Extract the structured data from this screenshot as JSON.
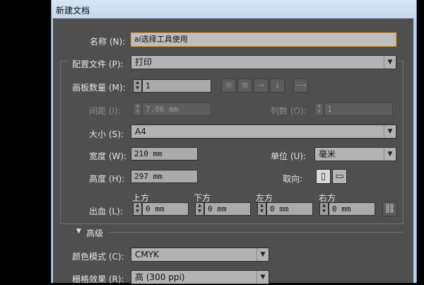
{
  "window": {
    "title": "新建文档"
  },
  "name": {
    "label": "名称 (N):",
    "value": "ai选择工具使用"
  },
  "profile": {
    "label": "配置文件 (P):",
    "value": "打印"
  },
  "artboards": {
    "label": "画板数量 (M):",
    "value": "1",
    "spacing_label": "间距 (I):",
    "spacing_value": "7.06 mm",
    "columns_label": "列数 (O):",
    "columns_value": "1",
    "layout_icons": [
      "grid-by-row-icon",
      "grid-by-column-icon",
      "arrange-by-row-icon",
      "arrange-by-column-icon",
      "right-to-left-icon"
    ]
  },
  "size": {
    "label": "大小 (S):",
    "value": "A4"
  },
  "width": {
    "label": "宽度 (W):",
    "value": "210 mm"
  },
  "units": {
    "label": "单位 (U):",
    "value": "毫米"
  },
  "height": {
    "label": "高度 (H):",
    "value": "297 mm"
  },
  "orientation": {
    "label": "取向:"
  },
  "bleed": {
    "label": "出血 (L):",
    "top_label": "上方",
    "top_value": "0 mm",
    "bottom_label": "下方",
    "bottom_value": "0 mm",
    "left_label": "左方",
    "left_value": "0 mm",
    "right_label": "右方",
    "right_value": "0 mm"
  },
  "advanced": {
    "label": "高级"
  },
  "color_mode": {
    "label": "颜色模式 (C):",
    "value": "CMYK"
  },
  "raster": {
    "label": "栅格效果 (R):",
    "value": "高 (300 ppi)"
  }
}
